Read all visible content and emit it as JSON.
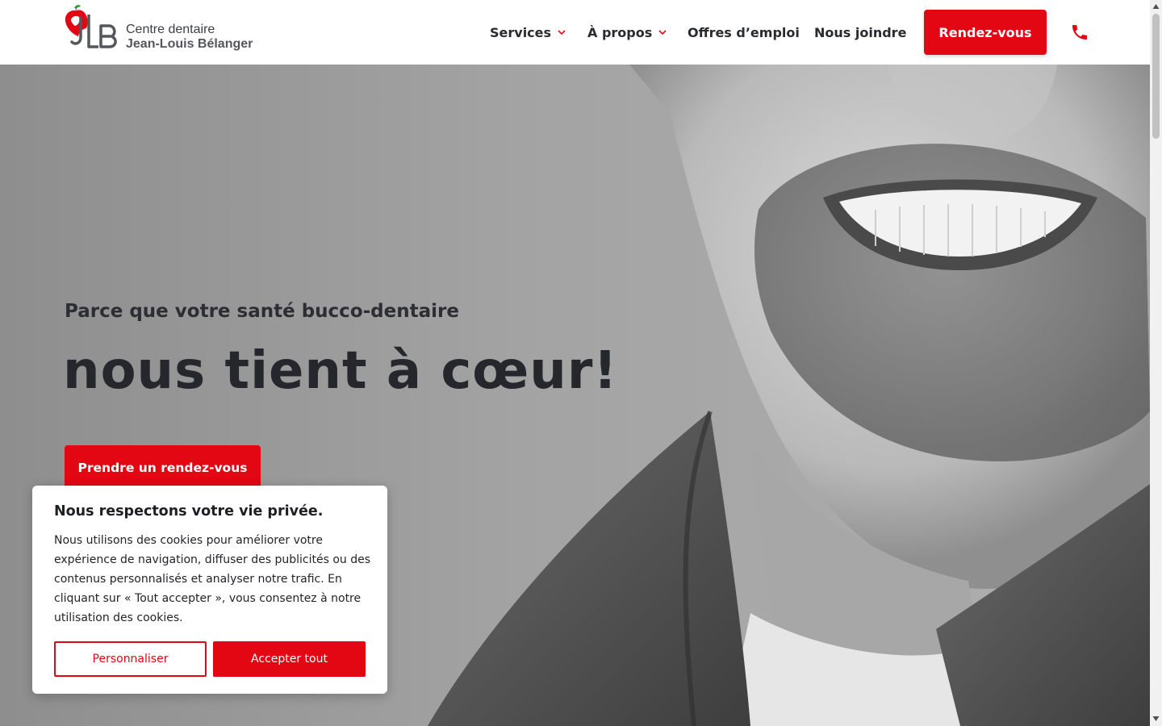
{
  "brand": {
    "logo_initials": "JLB",
    "line1": "Centre dentaire",
    "line2": "Jean-Louis Bélanger",
    "accent_color": "#e30613"
  },
  "nav": {
    "items": [
      {
        "label": "Services",
        "has_dropdown": true
      },
      {
        "label": "À propos",
        "has_dropdown": true
      },
      {
        "label": "Offres d’emploi",
        "has_dropdown": false
      },
      {
        "label": "Nous joindre",
        "has_dropdown": false
      }
    ],
    "cta_label": "Rendez-vous",
    "phone_icon": "phone-icon"
  },
  "hero": {
    "subtitle": "Parce que votre santé bucco-dentaire",
    "title": "nous tient à cœur!",
    "button_label": "Prendre un rendez-vous"
  },
  "cookie_banner": {
    "title": "Nous respectons votre vie privée.",
    "body": "Nous utilisons des cookies pour améliorer votre expérience de navigation, diffuser des publicités ou des contenus personnalisés et analyser notre trafic. En cliquant sur « Tout accepter », vous consentez à notre utilisation des cookies.",
    "customize_label": "Personnaliser",
    "accept_label": "Accepter tout"
  }
}
